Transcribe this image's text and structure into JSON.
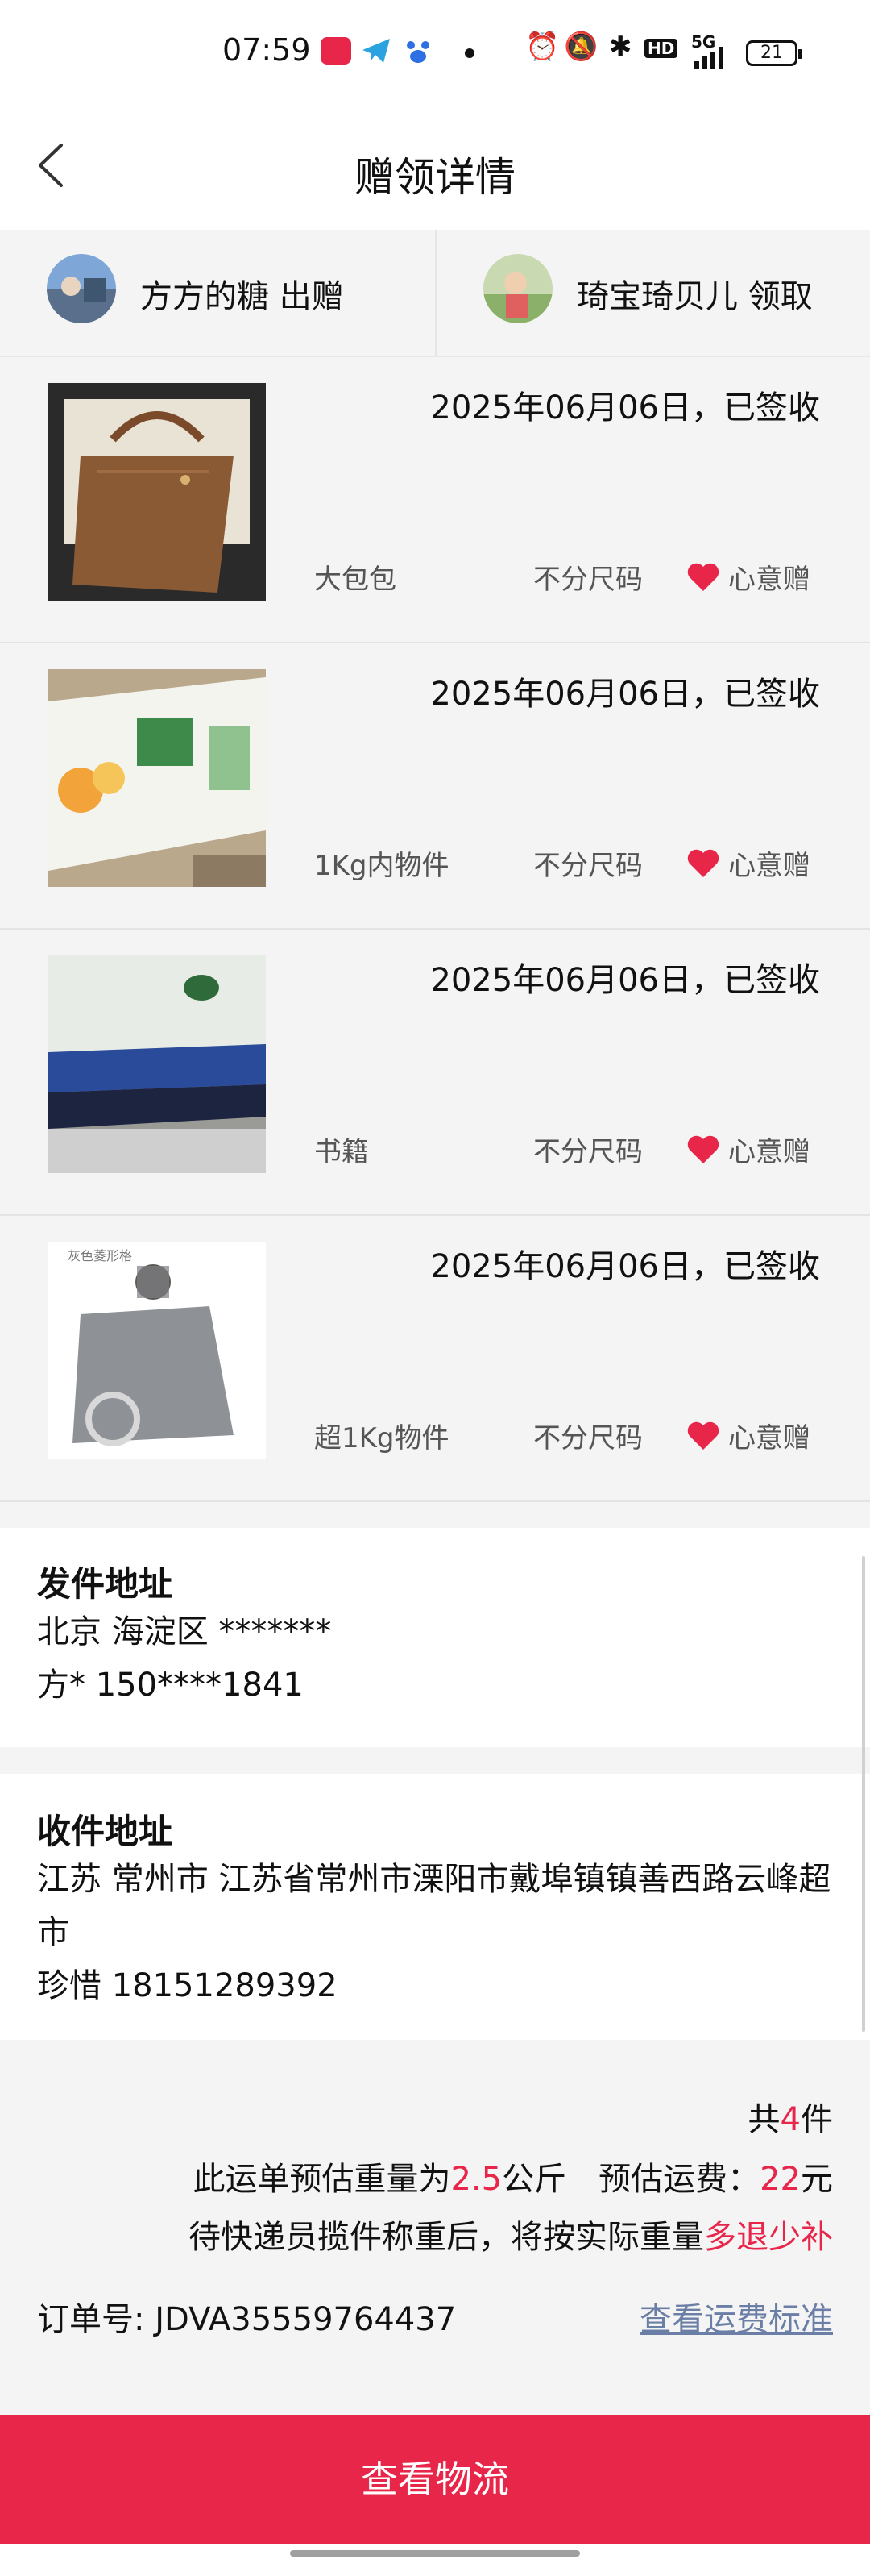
{
  "status_bar": {
    "time": "07:59",
    "battery": "21",
    "network_label": "5G",
    "hd_label": "HD",
    "icons": [
      "xiaohongshu-app-icon",
      "telegram-icon",
      "baidu-icon",
      "dot-icon",
      "alarm-icon",
      "mute-icon",
      "bluetooth-icon",
      "hd-icon",
      "signal-icon",
      "battery-icon"
    ],
    "colors": {
      "app_red": "#e8264a",
      "telegram_blue": "#2aa3e0",
      "baidu_blue": "#2f6fe4"
    }
  },
  "header": {
    "title": "赠领详情",
    "back_icon": "chevron-left-icon"
  },
  "parties": {
    "giver": {
      "label": "方方的糖 出赠"
    },
    "receiver": {
      "label": "琦宝琦贝儿 领取"
    }
  },
  "items": [
    {
      "status": "2025年06月06日，已签收",
      "category": "大包包",
      "size": "不分尺码",
      "tag": "心意赠"
    },
    {
      "status": "2025年06月06日，已签收",
      "category": "1Kg内物件",
      "size": "不分尺码",
      "tag": "心意赠"
    },
    {
      "status": "2025年06月06日，已签收",
      "category": "书籍",
      "size": "不分尺码",
      "tag": "心意赠"
    },
    {
      "status": "2025年06月06日，已签收",
      "category": "超1Kg物件",
      "size": "不分尺码",
      "tag": "心意赠",
      "image_caption": "灰色菱形格"
    }
  ],
  "sender_address": {
    "title": "发件地址",
    "region": "北京 海淀区 *******",
    "contact": "方* 150****1841"
  },
  "receiver_address": {
    "title": "收件地址",
    "address": "江苏 常州市 江苏省常州市溧阳市戴埠镇镇善西路云峰超市",
    "contact": "珍惜 18151289392"
  },
  "summary": {
    "count_prefix": "共",
    "count_value": "4",
    "count_suffix": "件",
    "weight_prefix": "此运单预估重量为",
    "weight_value": "2.5",
    "weight_suffix": "公斤",
    "fee_prefix": "预估运费：",
    "fee_value": "22",
    "fee_suffix": "元",
    "note_prefix": "待快递员揽件称重后，将按实际重量",
    "note_highlight": "多退少补",
    "order_label": "订单号:",
    "order_number": "JDVA35559764437",
    "fee_standard_link": "查看运费标准"
  },
  "actions": {
    "view_logistics": "查看物流"
  },
  "colors": {
    "accent": "#e8264a",
    "link": "#6b7fa6",
    "background_gray": "#f4f4f4"
  }
}
